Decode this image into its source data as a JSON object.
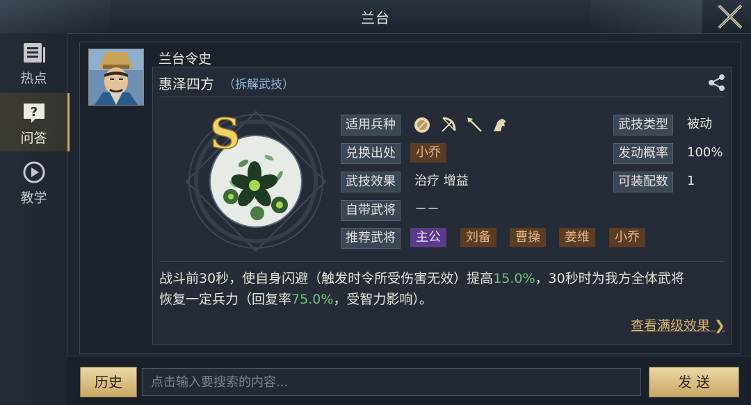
{
  "header": {
    "title": "兰台"
  },
  "sidebar": {
    "items": [
      {
        "label": "热点",
        "icon": "document-list-icon",
        "active": false
      },
      {
        "label": "问答",
        "icon": "question-bubble-icon",
        "active": true
      },
      {
        "label": "教学",
        "icon": "play-circle-icon",
        "active": false
      }
    ]
  },
  "post": {
    "author": "兰台令史",
    "skill_name": "惠泽四方",
    "decompose_link": "（拆解武技）",
    "grade": "S",
    "fields": {
      "troop_type_label": "适用兵种",
      "troop_icons": [
        "shield-icon",
        "bow-icon",
        "spear-icon",
        "horse-icon"
      ],
      "skill_type_label": "武技类型",
      "skill_type_value": "被动",
      "source_label": "兑换出处",
      "source_value": "小乔",
      "trigger_rate_label": "发动概率",
      "trigger_rate_value": "100%",
      "effect_label": "武技效果",
      "effect_value": "治疗 增益",
      "equip_count_label": "可装配数",
      "equip_count_value": "1",
      "own_general_label": "自带武将",
      "own_general_value": "－－",
      "recommend_label": "推荐武将",
      "recommend": [
        "主公",
        "刘备",
        "曹操",
        "姜维",
        "小乔"
      ]
    },
    "description": {
      "part1": "战斗前30秒，使自身闪避（触发时令所受伤害无效）提高",
      "hl1": "15.0%",
      "part2": "，30秒时为我方全体武将",
      "part3": "恢复一定兵力（回复率",
      "hl2": "75.0%",
      "part4": "，受智力影响）。"
    },
    "full_effect_link": "查看满级效果"
  },
  "bottom": {
    "history_label": "历史",
    "search_placeholder": "点击输入要搜索的内容...",
    "send_label": "发 送"
  },
  "colors": {
    "accent_gold": "#d6b36a",
    "highlight_green": "#6cc27a",
    "chip_brown": "#5a3d24",
    "chip_purple": "#5c3a8c"
  }
}
